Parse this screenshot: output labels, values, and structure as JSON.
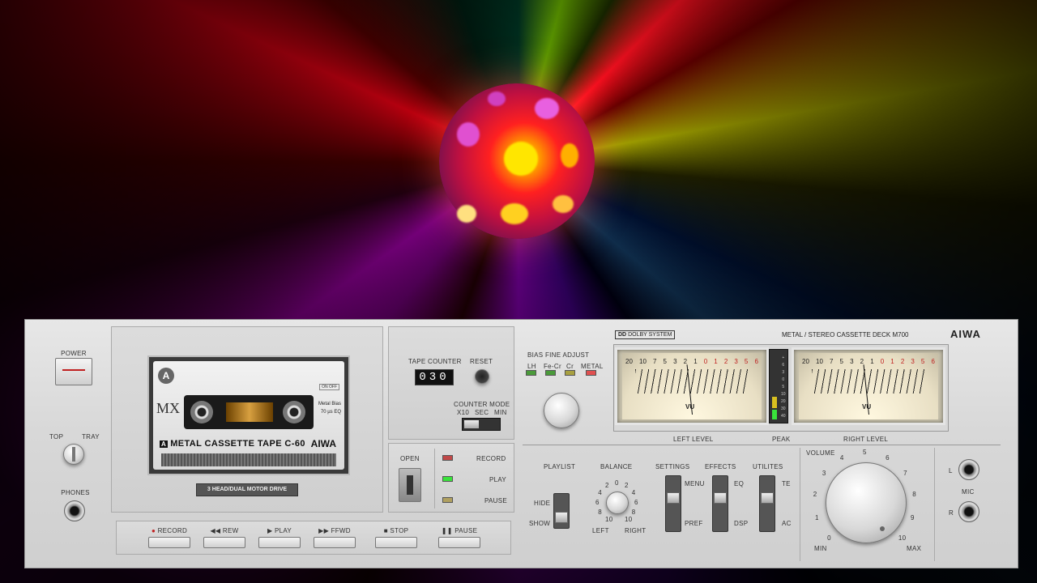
{
  "deck": {
    "brand": "AIWA",
    "model_line": "METAL / STEREO CASSETTE DECK M700",
    "dolby": "DOLBY SYSTEM",
    "power_label": "POWER",
    "top_label": "TOP",
    "tray_label": "TRAY",
    "phones_label": "PHONES"
  },
  "cassette": {
    "side": "A",
    "type": "MX",
    "on_off": "ON OFF",
    "bias": "Metal Bias",
    "eq": "70 µs EQ",
    "title": "METAL CASSETTE TAPE C-60",
    "brand": "AIWA",
    "drive": "3 HEAD/DUAL MOTOR DRIVE"
  },
  "counter": {
    "label": "TAPE COUNTER",
    "value": "030",
    "reset": "RESET",
    "mode_label": "COUNTER MODE",
    "modes": [
      "X10",
      "SEC",
      "MIN"
    ]
  },
  "status": {
    "open": "OPEN",
    "record": "RECORD",
    "play": "PLAY",
    "pause": "PAUSE"
  },
  "transport": [
    "RECORD",
    "REW",
    "PLAY",
    "FFWD",
    "STOP",
    "PAUSE"
  ],
  "transport_icons": [
    "record-dot-icon",
    "rewind-icon",
    "play-icon",
    "fast-forward-icon",
    "stop-icon",
    "pause-icon"
  ],
  "bias": {
    "label": "BIAS FINE ADJUST",
    "types": [
      "LH",
      "Fe-Cr",
      "Cr",
      "METAL"
    ]
  },
  "meters": {
    "left": "LEFT LEVEL",
    "peak": "PEAK",
    "right": "RIGHT LEVEL",
    "scale": [
      "20",
      "10",
      "7",
      "5",
      "3",
      "2",
      "1",
      "0",
      "1",
      "2",
      "3",
      "5",
      "6"
    ],
    "vu": "VU",
    "peak_scale": [
      "+",
      "6",
      "3",
      "0",
      "5",
      "10",
      "20",
      "30",
      "40"
    ]
  },
  "controls": {
    "playlist": "PLAYLIST",
    "hide": "HIDE",
    "show": "SHOW",
    "balance": "BALANCE",
    "left": "LEFT",
    "right": "RIGHT",
    "balance_scale": [
      "0",
      "2",
      "2",
      "4",
      "4",
      "6",
      "6",
      "8",
      "8",
      "10",
      "10"
    ],
    "settings": "SETTINGS",
    "menu": "MENU",
    "pref": "PREF",
    "effects": "EFFECTS",
    "eq": "EQ",
    "dsp": "DSP",
    "utilities": "UTILITES",
    "te": "TE",
    "ac": "AC",
    "volume": "VOLUME",
    "min": "MIN",
    "max": "MAX",
    "volume_scale": [
      "0",
      "1",
      "2",
      "3",
      "4",
      "5",
      "6",
      "7",
      "8",
      "9",
      "10"
    ],
    "mic": "MIC",
    "mic_l": "L",
    "mic_r": "R"
  },
  "colors": {
    "led_green": "#39e33b",
    "led_red": "#d84545",
    "led_amber": "#c9b860",
    "needle_red": "#d02020"
  }
}
